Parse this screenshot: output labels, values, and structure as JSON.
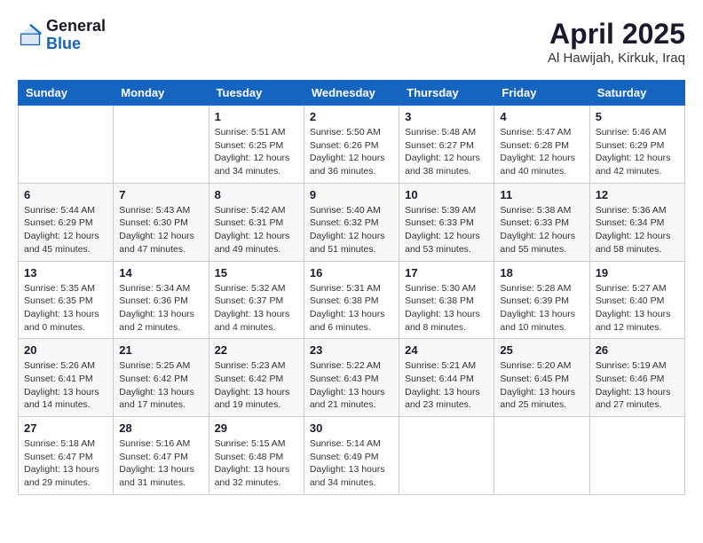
{
  "header": {
    "logo_general": "General",
    "logo_blue": "Blue",
    "title": "April 2025",
    "location": "Al Hawijah, Kirkuk, Iraq"
  },
  "weekdays": [
    "Sunday",
    "Monday",
    "Tuesday",
    "Wednesday",
    "Thursday",
    "Friday",
    "Saturday"
  ],
  "weeks": [
    [
      {
        "day": "",
        "sunrise": "",
        "sunset": "",
        "daylight": ""
      },
      {
        "day": "",
        "sunrise": "",
        "sunset": "",
        "daylight": ""
      },
      {
        "day": "1",
        "sunrise": "Sunrise: 5:51 AM",
        "sunset": "Sunset: 6:25 PM",
        "daylight": "Daylight: 12 hours and 34 minutes."
      },
      {
        "day": "2",
        "sunrise": "Sunrise: 5:50 AM",
        "sunset": "Sunset: 6:26 PM",
        "daylight": "Daylight: 12 hours and 36 minutes."
      },
      {
        "day": "3",
        "sunrise": "Sunrise: 5:48 AM",
        "sunset": "Sunset: 6:27 PM",
        "daylight": "Daylight: 12 hours and 38 minutes."
      },
      {
        "day": "4",
        "sunrise": "Sunrise: 5:47 AM",
        "sunset": "Sunset: 6:28 PM",
        "daylight": "Daylight: 12 hours and 40 minutes."
      },
      {
        "day": "5",
        "sunrise": "Sunrise: 5:46 AM",
        "sunset": "Sunset: 6:29 PM",
        "daylight": "Daylight: 12 hours and 42 minutes."
      }
    ],
    [
      {
        "day": "6",
        "sunrise": "Sunrise: 5:44 AM",
        "sunset": "Sunset: 6:29 PM",
        "daylight": "Daylight: 12 hours and 45 minutes."
      },
      {
        "day": "7",
        "sunrise": "Sunrise: 5:43 AM",
        "sunset": "Sunset: 6:30 PM",
        "daylight": "Daylight: 12 hours and 47 minutes."
      },
      {
        "day": "8",
        "sunrise": "Sunrise: 5:42 AM",
        "sunset": "Sunset: 6:31 PM",
        "daylight": "Daylight: 12 hours and 49 minutes."
      },
      {
        "day": "9",
        "sunrise": "Sunrise: 5:40 AM",
        "sunset": "Sunset: 6:32 PM",
        "daylight": "Daylight: 12 hours and 51 minutes."
      },
      {
        "day": "10",
        "sunrise": "Sunrise: 5:39 AM",
        "sunset": "Sunset: 6:33 PM",
        "daylight": "Daylight: 12 hours and 53 minutes."
      },
      {
        "day": "11",
        "sunrise": "Sunrise: 5:38 AM",
        "sunset": "Sunset: 6:33 PM",
        "daylight": "Daylight: 12 hours and 55 minutes."
      },
      {
        "day": "12",
        "sunrise": "Sunrise: 5:36 AM",
        "sunset": "Sunset: 6:34 PM",
        "daylight": "Daylight: 12 hours and 58 minutes."
      }
    ],
    [
      {
        "day": "13",
        "sunrise": "Sunrise: 5:35 AM",
        "sunset": "Sunset: 6:35 PM",
        "daylight": "Daylight: 13 hours and 0 minutes."
      },
      {
        "day": "14",
        "sunrise": "Sunrise: 5:34 AM",
        "sunset": "Sunset: 6:36 PM",
        "daylight": "Daylight: 13 hours and 2 minutes."
      },
      {
        "day": "15",
        "sunrise": "Sunrise: 5:32 AM",
        "sunset": "Sunset: 6:37 PM",
        "daylight": "Daylight: 13 hours and 4 minutes."
      },
      {
        "day": "16",
        "sunrise": "Sunrise: 5:31 AM",
        "sunset": "Sunset: 6:38 PM",
        "daylight": "Daylight: 13 hours and 6 minutes."
      },
      {
        "day": "17",
        "sunrise": "Sunrise: 5:30 AM",
        "sunset": "Sunset: 6:38 PM",
        "daylight": "Daylight: 13 hours and 8 minutes."
      },
      {
        "day": "18",
        "sunrise": "Sunrise: 5:28 AM",
        "sunset": "Sunset: 6:39 PM",
        "daylight": "Daylight: 13 hours and 10 minutes."
      },
      {
        "day": "19",
        "sunrise": "Sunrise: 5:27 AM",
        "sunset": "Sunset: 6:40 PM",
        "daylight": "Daylight: 13 hours and 12 minutes."
      }
    ],
    [
      {
        "day": "20",
        "sunrise": "Sunrise: 5:26 AM",
        "sunset": "Sunset: 6:41 PM",
        "daylight": "Daylight: 13 hours and 14 minutes."
      },
      {
        "day": "21",
        "sunrise": "Sunrise: 5:25 AM",
        "sunset": "Sunset: 6:42 PM",
        "daylight": "Daylight: 13 hours and 17 minutes."
      },
      {
        "day": "22",
        "sunrise": "Sunrise: 5:23 AM",
        "sunset": "Sunset: 6:42 PM",
        "daylight": "Daylight: 13 hours and 19 minutes."
      },
      {
        "day": "23",
        "sunrise": "Sunrise: 5:22 AM",
        "sunset": "Sunset: 6:43 PM",
        "daylight": "Daylight: 13 hours and 21 minutes."
      },
      {
        "day": "24",
        "sunrise": "Sunrise: 5:21 AM",
        "sunset": "Sunset: 6:44 PM",
        "daylight": "Daylight: 13 hours and 23 minutes."
      },
      {
        "day": "25",
        "sunrise": "Sunrise: 5:20 AM",
        "sunset": "Sunset: 6:45 PM",
        "daylight": "Daylight: 13 hours and 25 minutes."
      },
      {
        "day": "26",
        "sunrise": "Sunrise: 5:19 AM",
        "sunset": "Sunset: 6:46 PM",
        "daylight": "Daylight: 13 hours and 27 minutes."
      }
    ],
    [
      {
        "day": "27",
        "sunrise": "Sunrise: 5:18 AM",
        "sunset": "Sunset: 6:47 PM",
        "daylight": "Daylight: 13 hours and 29 minutes."
      },
      {
        "day": "28",
        "sunrise": "Sunrise: 5:16 AM",
        "sunset": "Sunset: 6:47 PM",
        "daylight": "Daylight: 13 hours and 31 minutes."
      },
      {
        "day": "29",
        "sunrise": "Sunrise: 5:15 AM",
        "sunset": "Sunset: 6:48 PM",
        "daylight": "Daylight: 13 hours and 32 minutes."
      },
      {
        "day": "30",
        "sunrise": "Sunrise: 5:14 AM",
        "sunset": "Sunset: 6:49 PM",
        "daylight": "Daylight: 13 hours and 34 minutes."
      },
      {
        "day": "",
        "sunrise": "",
        "sunset": "",
        "daylight": ""
      },
      {
        "day": "",
        "sunrise": "",
        "sunset": "",
        "daylight": ""
      },
      {
        "day": "",
        "sunrise": "",
        "sunset": "",
        "daylight": ""
      }
    ]
  ]
}
